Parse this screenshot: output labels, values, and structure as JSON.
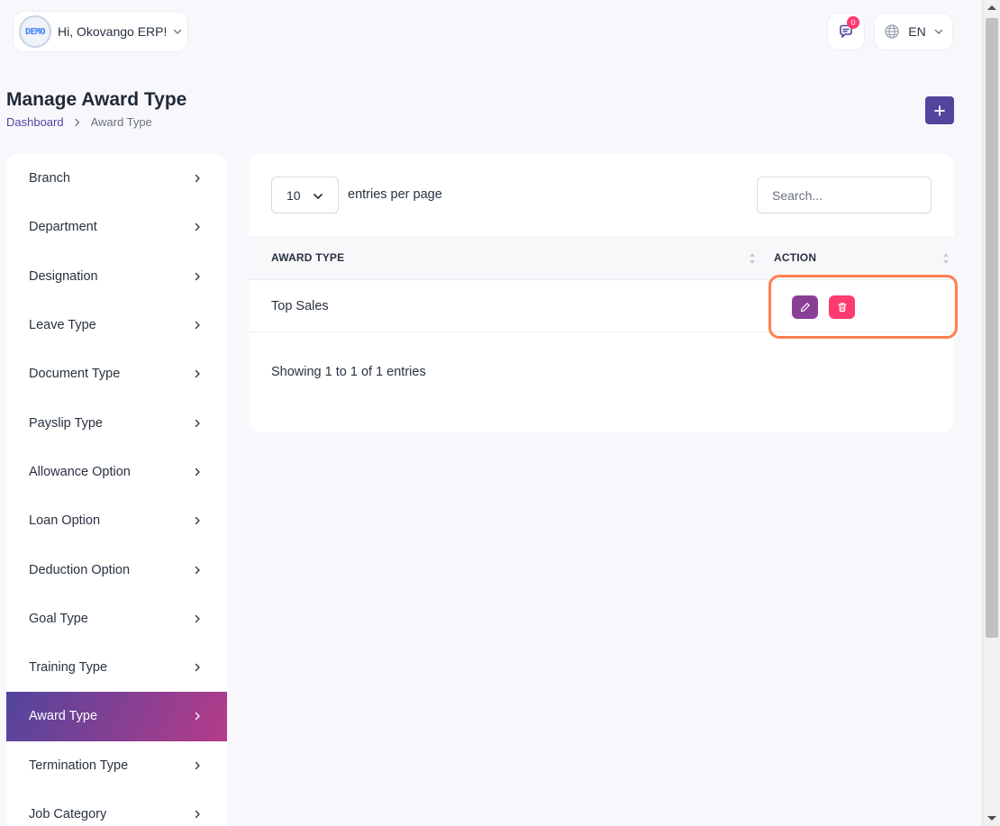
{
  "header": {
    "logo_text": "DEMO",
    "greeting": "Hi, Okovango ERP!",
    "notification_count": "0",
    "language": "EN"
  },
  "page": {
    "title": "Manage Award Type",
    "breadcrumb": [
      "Dashboard",
      "Award Type"
    ]
  },
  "sidebar": {
    "items": [
      {
        "label": "Branch"
      },
      {
        "label": "Department"
      },
      {
        "label": "Designation"
      },
      {
        "label": "Leave Type"
      },
      {
        "label": "Document Type"
      },
      {
        "label": "Payslip Type"
      },
      {
        "label": "Allowance Option"
      },
      {
        "label": "Loan Option"
      },
      {
        "label": "Deduction Option"
      },
      {
        "label": "Goal Type"
      },
      {
        "label": "Training Type"
      },
      {
        "label": "Award Type"
      },
      {
        "label": "Termination Type"
      },
      {
        "label": "Job Category"
      }
    ],
    "active": "Award Type"
  },
  "table": {
    "entries_value": "10",
    "entries_label": "entries per page",
    "search_placeholder": "Search...",
    "columns": [
      "AWARD TYPE",
      "ACTION"
    ],
    "rows": [
      {
        "award_type": "Top Sales"
      }
    ],
    "footer": "Showing 1 to 1 of 1 entries"
  },
  "colors": {
    "primary": "#51459d",
    "edit": "#8a3f96",
    "delete": "#ff3a6e",
    "highlight": "#ff7f4f"
  },
  "icons": {
    "add": "plus-icon",
    "edit": "pencil-icon",
    "delete": "trash-icon",
    "messages": "chat-icon",
    "language": "globe-icon"
  }
}
